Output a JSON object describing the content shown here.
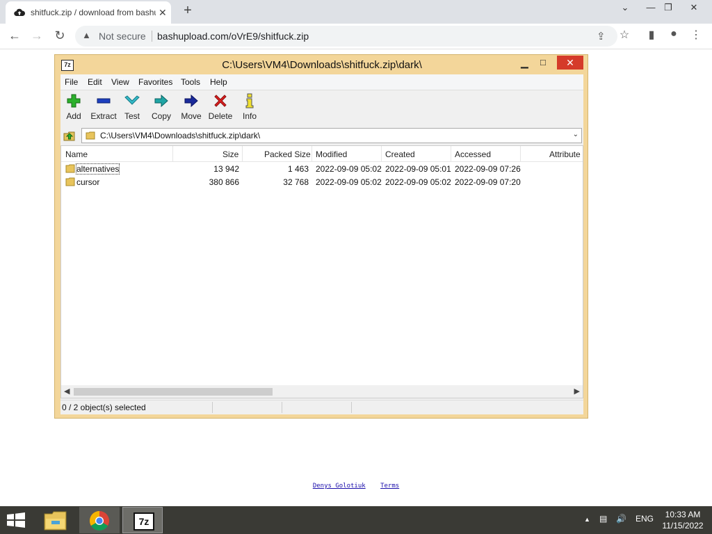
{
  "browser": {
    "tab_title": "shitfuck.zip / download from bashupload",
    "tab_close": "✕",
    "new_tab": "+",
    "security_label": "Not secure",
    "url": "bashupload.com/oVrE9/shitfuck.zip"
  },
  "sevenzip": {
    "logo": "7z",
    "title": "C:\\Users\\VM4\\Downloads\\shitfuck.zip\\dark\\",
    "menu": [
      "File",
      "Edit",
      "View",
      "Favorites",
      "Tools",
      "Help"
    ],
    "toolbar": [
      "Add",
      "Extract",
      "Test",
      "Copy",
      "Move",
      "Delete",
      "Info"
    ],
    "path": "C:\\Users\\VM4\\Downloads\\shitfuck.zip\\dark\\",
    "columns": [
      "Name",
      "Size",
      "Packed Size",
      "Modified",
      "Created",
      "Accessed",
      "Attribute"
    ],
    "rows": [
      {
        "name": "alternatives",
        "size": "13 942",
        "packed": "1 463",
        "modified": "2022-09-09 05:02",
        "created": "2022-09-09 05:01",
        "accessed": "2022-09-09 07:26"
      },
      {
        "name": "cursor",
        "size": "380 866",
        "packed": "32 768",
        "modified": "2022-09-09 05:02",
        "created": "2022-09-09 05:02",
        "accessed": "2022-09-09 07:20"
      }
    ],
    "status": "0 / 2 object(s) selected"
  },
  "footer": {
    "author": "Denys Golotiuk",
    "terms": "Terms"
  },
  "taskbar": {
    "language": "ENG",
    "time": "10:33 AM",
    "date": "11/15/2022"
  },
  "colors": {
    "window_frame": "#f3d69a",
    "close_red": "#d53b2a",
    "taskbar": "#3a3a35"
  }
}
